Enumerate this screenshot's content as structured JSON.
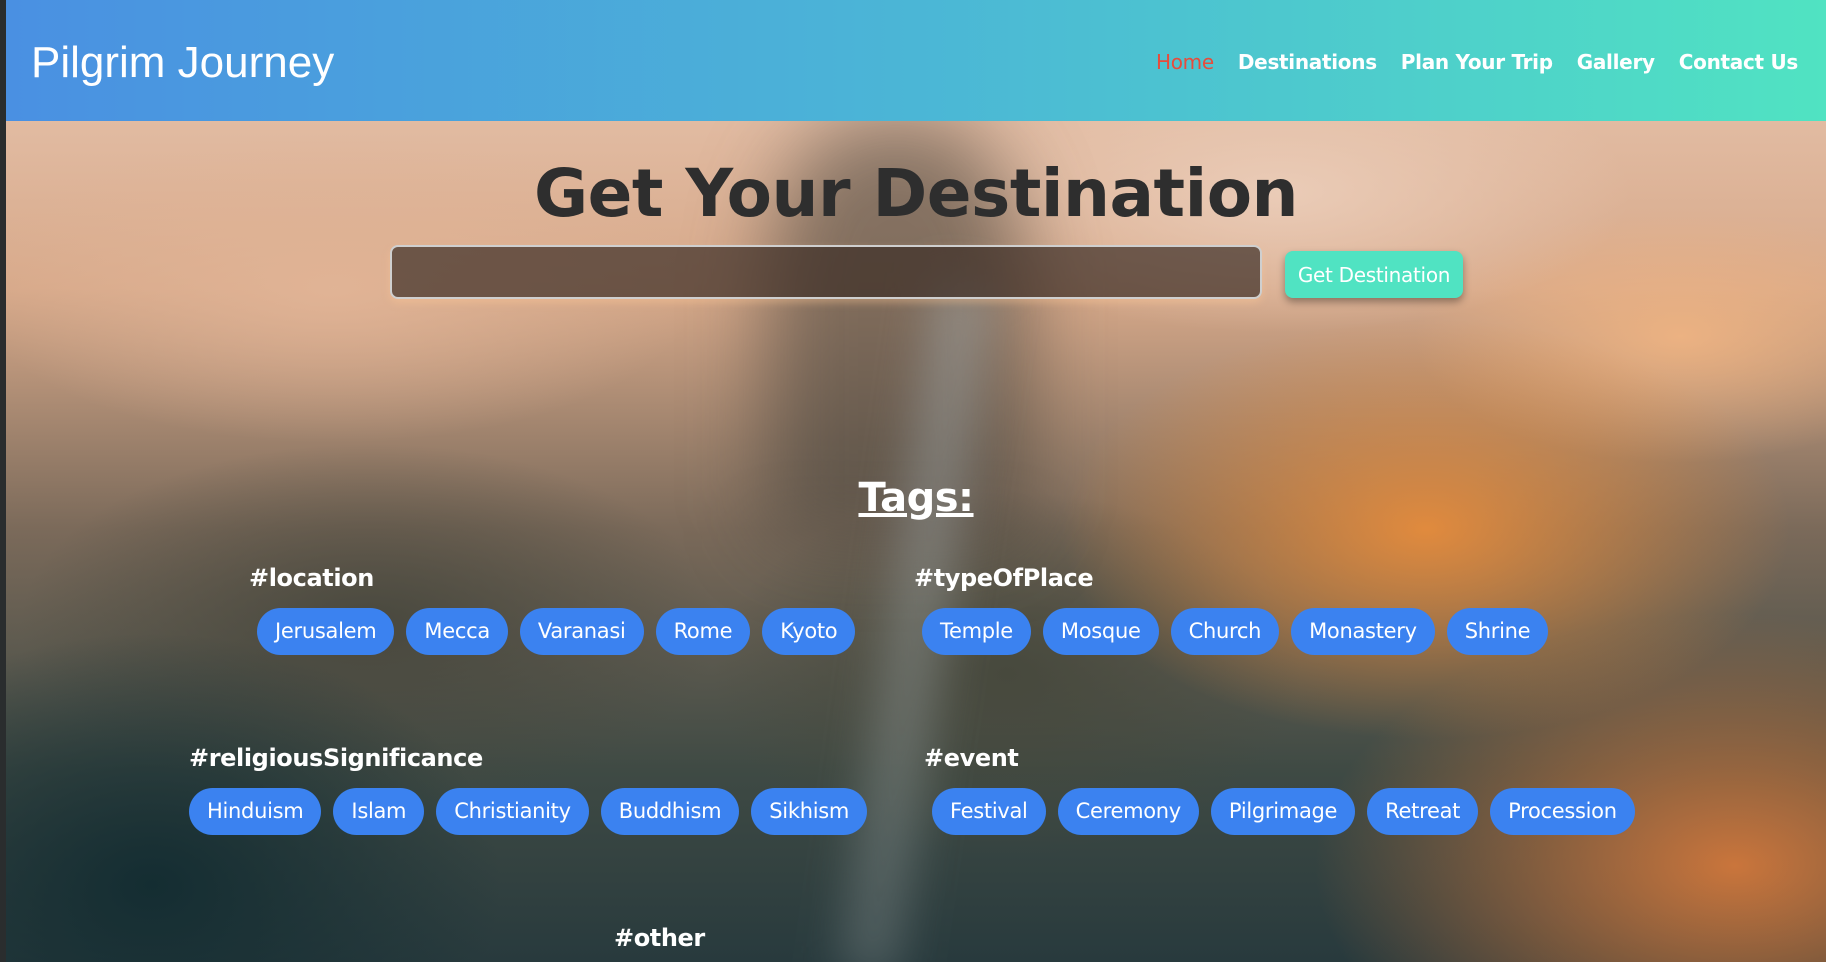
{
  "brand": "Pilgrim Journey",
  "nav": {
    "items": [
      {
        "label": "Home",
        "active": true
      },
      {
        "label": "Destinations"
      },
      {
        "label": "Plan Your Trip"
      },
      {
        "label": "Gallery"
      },
      {
        "label": "Contact Us"
      }
    ]
  },
  "search": {
    "title": "Get Your Destination",
    "input_value": "",
    "button_label": "Get Destination"
  },
  "tags": {
    "heading": "Tags:",
    "groups": [
      {
        "title": "#location",
        "items": [
          "Jerusalem",
          "Mecca",
          "Varanasi",
          "Rome",
          "Kyoto"
        ]
      },
      {
        "title": "#typeOfPlace",
        "items": [
          "Temple",
          "Mosque",
          "Church",
          "Monastery",
          "Shrine"
        ]
      },
      {
        "title": "#religiousSignificance",
        "items": [
          "Hinduism",
          "Islam",
          "Christianity",
          "Buddhism",
          "Sikhism"
        ]
      },
      {
        "title": "#event",
        "items": [
          "Festival",
          "Ceremony",
          "Pilgrimage",
          "Retreat",
          "Procession"
        ]
      },
      {
        "title": "#other",
        "items": []
      }
    ]
  },
  "colors": {
    "header_start": "#4a90e2",
    "header_end": "#50e3c2",
    "active_nav": "#e74c3c",
    "chip": "#3b82f0",
    "button": "#50e3c2"
  }
}
